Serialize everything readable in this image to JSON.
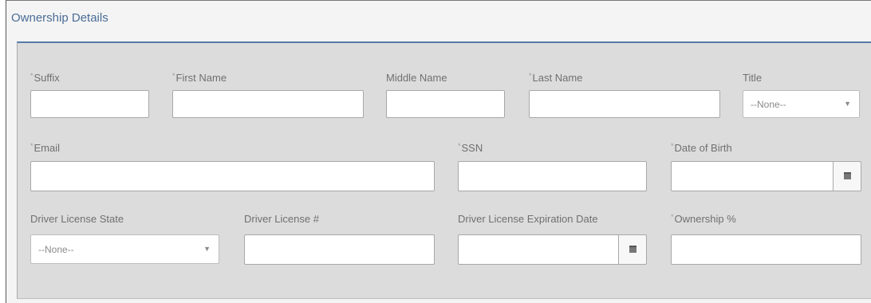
{
  "section": {
    "title": "Ownership Details"
  },
  "required_marker": "*",
  "fields": {
    "suffix": {
      "label": "Suffix",
      "value": ""
    },
    "first_name": {
      "label": "First Name",
      "value": ""
    },
    "middle_name": {
      "label": "Middle Name",
      "value": ""
    },
    "last_name": {
      "label": "Last Name",
      "value": ""
    },
    "title": {
      "label": "Title",
      "selected": "--None--"
    },
    "email": {
      "label": "Email",
      "value": ""
    },
    "ssn": {
      "label": "SSN",
      "value": ""
    },
    "dob": {
      "label": "Date of Birth",
      "value": ""
    },
    "dl_state": {
      "label": "Driver License State",
      "selected": "--None--"
    },
    "dl_number": {
      "label": "Driver License #",
      "value": ""
    },
    "dl_exp": {
      "label": "Driver License Expiration Date",
      "value": ""
    },
    "ownership": {
      "label": "Ownership %",
      "value": ""
    }
  },
  "icons": {
    "dropdown": "chevron-down-icon",
    "calendar": "calendar-icon"
  }
}
